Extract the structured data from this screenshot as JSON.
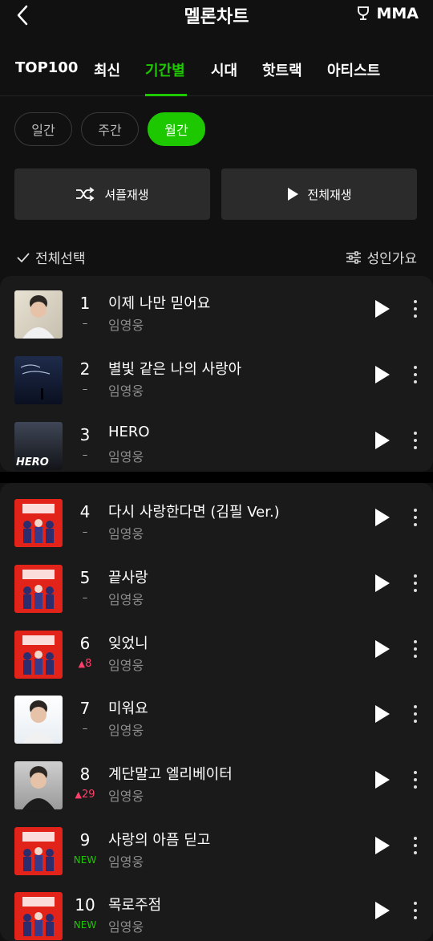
{
  "header": {
    "title": "멜론차트",
    "mma_label": "MMA"
  },
  "tabs": [
    {
      "label": "TOP100",
      "active": false
    },
    {
      "label": "최신",
      "active": false
    },
    {
      "label": "기간별",
      "active": true
    },
    {
      "label": "시대",
      "active": false
    },
    {
      "label": "핫트랙",
      "active": false
    },
    {
      "label": "아티스트",
      "active": false
    }
  ],
  "period": [
    {
      "label": "일간",
      "active": false
    },
    {
      "label": "주간",
      "active": false
    },
    {
      "label": "월간",
      "active": true
    }
  ],
  "actions": {
    "shuffle_label": "셔플재생",
    "play_all_label": "전체재생"
  },
  "list_controls": {
    "select_all_label": "전체선택",
    "adult_label": "성인가요"
  },
  "songs": [
    {
      "rank": "1",
      "change": "–",
      "change_type": "same",
      "title": "이제 나만 믿어요",
      "artist": "임영웅",
      "art": "portrait-light"
    },
    {
      "rank": "2",
      "change": "–",
      "change_type": "same",
      "title": "별빛 같은 나의 사랑아",
      "artist": "임영웅",
      "art": "night-sky"
    },
    {
      "rank": "3",
      "change": "–",
      "change_type": "same",
      "title": "HERO",
      "artist": "임영웅",
      "art": "dark-hero",
      "art_text": "HERO"
    },
    {
      "rank": "4",
      "change": "–",
      "change_type": "same",
      "title": "다시 사랑한다면 (김필 Ver.)",
      "artist": "임영웅",
      "art": "red-group"
    },
    {
      "rank": "5",
      "change": "–",
      "change_type": "same",
      "title": "끝사랑",
      "artist": "임영웅",
      "art": "red-group"
    },
    {
      "rank": "6",
      "change": "8",
      "change_type": "up",
      "title": "잊었니",
      "artist": "임영웅",
      "art": "red-group"
    },
    {
      "rank": "7",
      "change": "–",
      "change_type": "same",
      "title": "미워요",
      "artist": "임영웅",
      "art": "portrait-white"
    },
    {
      "rank": "8",
      "change": "29",
      "change_type": "up",
      "title": "계단말고 엘리베이터",
      "artist": "임영웅",
      "art": "portrait-gray"
    },
    {
      "rank": "9",
      "change": "NEW",
      "change_type": "new",
      "title": "사랑의 아픔 딛고",
      "artist": "임영웅",
      "art": "red-group"
    },
    {
      "rank": "10",
      "change": "NEW",
      "change_type": "new",
      "title": "목로주점",
      "artist": "임영웅",
      "art": "red-group"
    }
  ],
  "colors": {
    "accent": "#1ec800",
    "rank_up": "#ff3f6a",
    "background": "#111111",
    "card": "#1a1a1a"
  }
}
